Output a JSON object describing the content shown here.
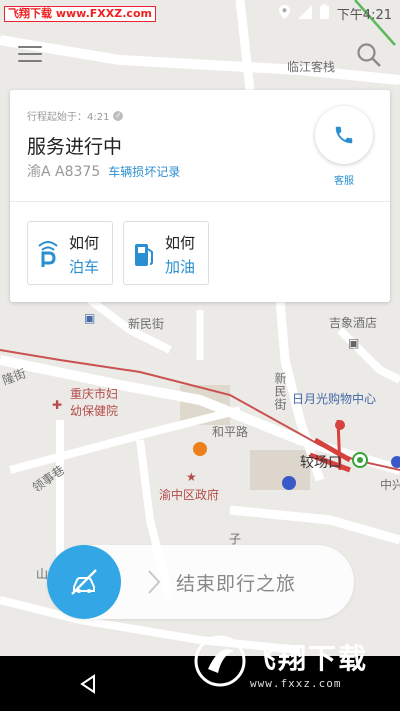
{
  "status_bar": {
    "watermark": "飞翔下载 www.FXXZ.com",
    "time": "下午4:21"
  },
  "map": {
    "labels": {
      "linjiang": "临江客栈",
      "xinmin": "新民街",
      "jixiang": "吉象酒店",
      "rishan": "日月光购物中心",
      "xinmin_v": "新民街",
      "chongqing1": "重庆市妇",
      "chongqing2": "幼保健院",
      "heping": "和平路",
      "jiaochang": "较场口",
      "yuzhong": "渝中区政府",
      "zhong": "中兴",
      "ling": "领事巷",
      "long": "隆街",
      "shan": "山",
      "zi": "子"
    }
  },
  "card": {
    "trip_started": "行程起始于：4:21",
    "title": "服务进行中",
    "plate": "渝A A8375",
    "damage_link": "车辆损坏记录",
    "call_label": "客服",
    "tiles": [
      {
        "line1": "如何",
        "line2": "泊车",
        "icon": "parking-icon"
      },
      {
        "line1": "如何",
        "line2": "加油",
        "icon": "fuel-icon"
      }
    ]
  },
  "slider": {
    "label": "结束即行之旅",
    "icon": "no-car-icon"
  },
  "watermark2": {
    "text": "飞翔下载",
    "sub": "www.fxxz.com"
  },
  "colors": {
    "accent": "#2a8fd1",
    "knob": "#33a7e5",
    "metro_line": "#c9514f"
  }
}
